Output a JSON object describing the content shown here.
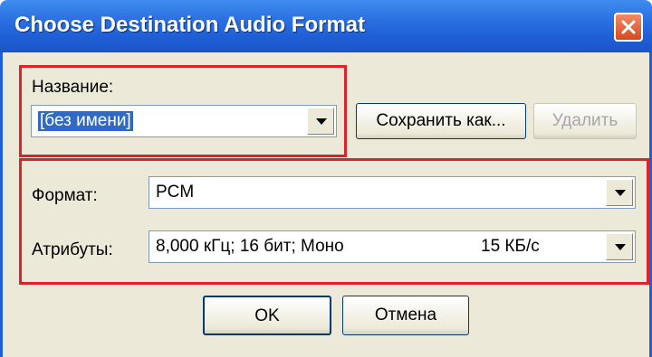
{
  "window": {
    "title": "Choose Destination Audio Format"
  },
  "name_section": {
    "label": "Название:",
    "selected": "[без имени]",
    "save_as_button": "Сохранить как...",
    "delete_button": "Удалить"
  },
  "format_section": {
    "format_label": "Формат:",
    "format_value": "PCM",
    "attributes_label": "Атрибуты:",
    "attributes_value": "8,000 кГц; 16 бит; Моно",
    "attributes_rate": "15 КБ/с"
  },
  "buttons": {
    "ok": "OK",
    "cancel": "Отмена"
  },
  "icons": {
    "close": "close-icon",
    "dropdown": "chevron-down-icon"
  },
  "colors": {
    "titlebar": "#2a6fe0",
    "highlight": "#e0202a",
    "selection": "#316ac5"
  }
}
